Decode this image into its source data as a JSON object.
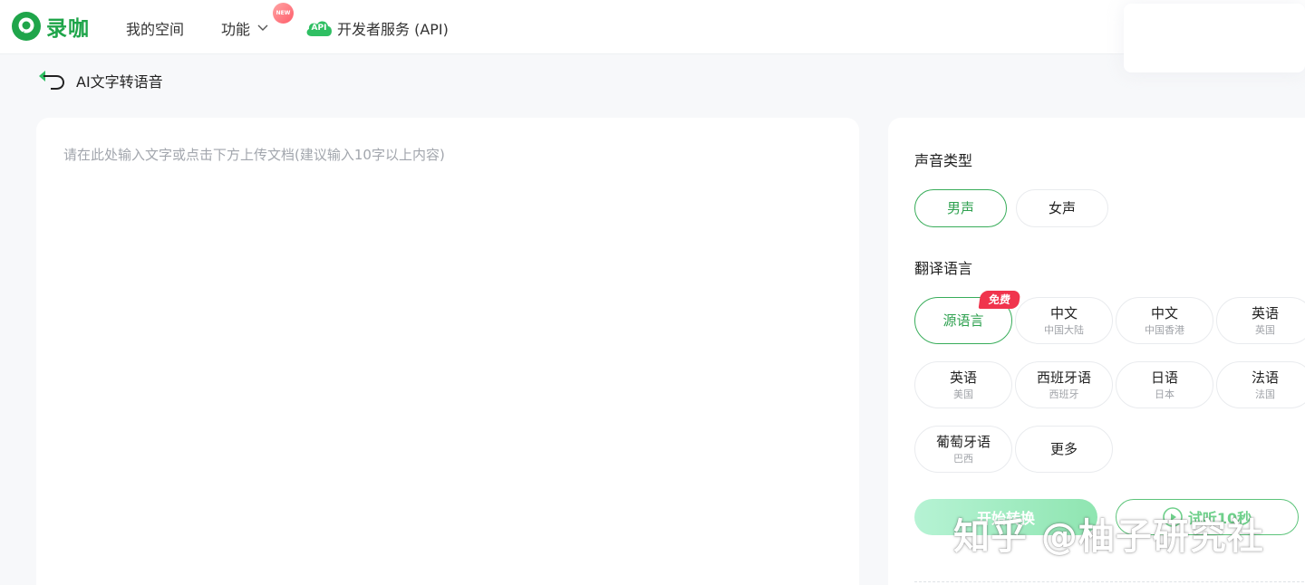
{
  "header": {
    "logo_text": "录咖",
    "nav": {
      "space": "我的空间",
      "features": "功能",
      "new_badge": "NEW",
      "api_icon": "API",
      "developer": "开发者服务 (API)"
    }
  },
  "page": {
    "back_title": "AI文字转语音"
  },
  "editor": {
    "placeholder": "请在此处输入文字或点击下方上传文档(建议输入10字以上内容)",
    "value": ""
  },
  "settings": {
    "voice_type_title": "声音类型",
    "voices": [
      {
        "label": "男声",
        "selected": true
      },
      {
        "label": "女声",
        "selected": false
      }
    ],
    "language_title": "翻译语言",
    "free_badge": "免费",
    "languages": [
      {
        "label": "源语言",
        "sub": "",
        "selected": true
      },
      {
        "label": "中文",
        "sub": "中国大陆"
      },
      {
        "label": "中文",
        "sub": "中国香港"
      },
      {
        "label": "英语",
        "sub": "英国"
      },
      {
        "label": "英语",
        "sub": "美国"
      },
      {
        "label": "西班牙语",
        "sub": "西班牙"
      },
      {
        "label": "日语",
        "sub": "日本"
      },
      {
        "label": "法语",
        "sub": "法国"
      },
      {
        "label": "葡萄牙语",
        "sub": "巴西"
      },
      {
        "label": "更多",
        "sub": ""
      }
    ],
    "start_button": "开始转换",
    "trial_button": "试听10秒"
  },
  "watermark": "知乎 @柚子研究社",
  "colors": {
    "brand_green": "#1fa54a",
    "selected_border": "#38ad5a",
    "free_badge_red": "#f0344d"
  }
}
